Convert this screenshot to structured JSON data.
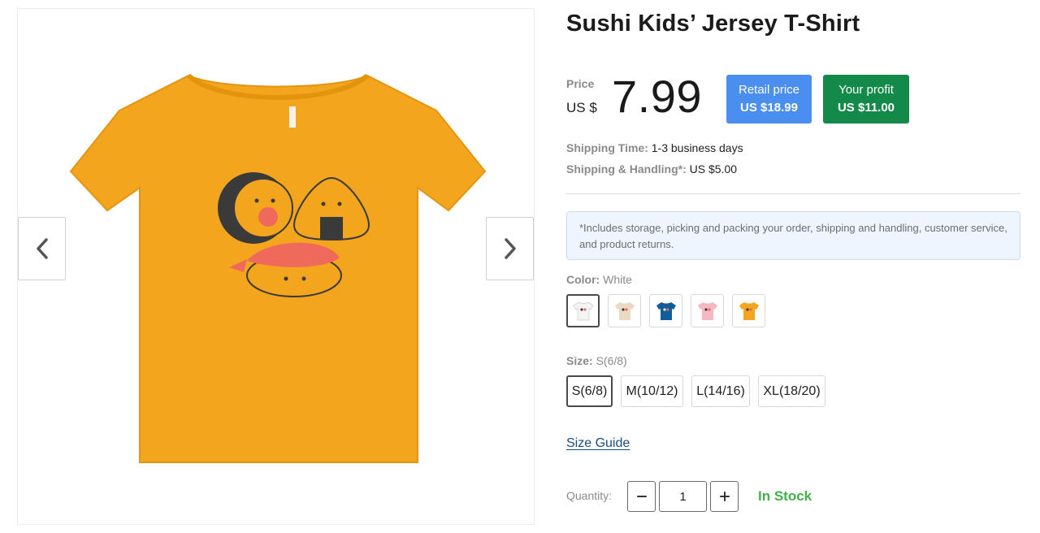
{
  "product": {
    "title": "Sushi Kids’ Jersey T-Shirt",
    "image_alt": "Gold kids t-shirt with sushi print"
  },
  "gallery": {
    "prev_icon": "chevron-left-icon",
    "next_icon": "chevron-right-icon"
  },
  "price": {
    "label": "Price",
    "currency": "US $",
    "value": "7.99"
  },
  "retail_badge": {
    "label": "Retail price",
    "value": "US $18.99",
    "color": "#4a8ff0"
  },
  "profit_badge": {
    "label": "Your profit",
    "value": "US $11.00",
    "color": "#13894a"
  },
  "shipping": {
    "time_label": "Shipping Time:",
    "time_value": "1-3 business days",
    "handling_label": "Shipping & Handling*:",
    "handling_value": "US $5.00"
  },
  "note": "*Includes storage, picking and packing your order, shipping and handling, customer service, and product returns.",
  "color": {
    "label": "Color:",
    "selected": "White",
    "swatches": [
      {
        "name": "White",
        "hex": "#f4f4f4"
      },
      {
        "name": "Natural",
        "hex": "#ecd9c4"
      },
      {
        "name": "Royal Blue",
        "hex": "#115c9a"
      },
      {
        "name": "Pink",
        "hex": "#f6b7c2"
      },
      {
        "name": "Gold",
        "hex": "#f2a51d"
      }
    ]
  },
  "size": {
    "label": "Size:",
    "selected": "S(6/8)",
    "options": [
      "S(6/8)",
      "M(10/12)",
      "L(14/16)",
      "XL(18/20)"
    ]
  },
  "size_guide": "Size Guide",
  "quantity": {
    "label": "Quantity:",
    "value": "1",
    "minus_icon": "minus-icon",
    "plus_icon": "plus-icon"
  },
  "stock_status": "In Stock",
  "colors": {
    "stock": "#3fb24a",
    "link": "#1a4d7a",
    "shirt": "#f2a51d"
  }
}
